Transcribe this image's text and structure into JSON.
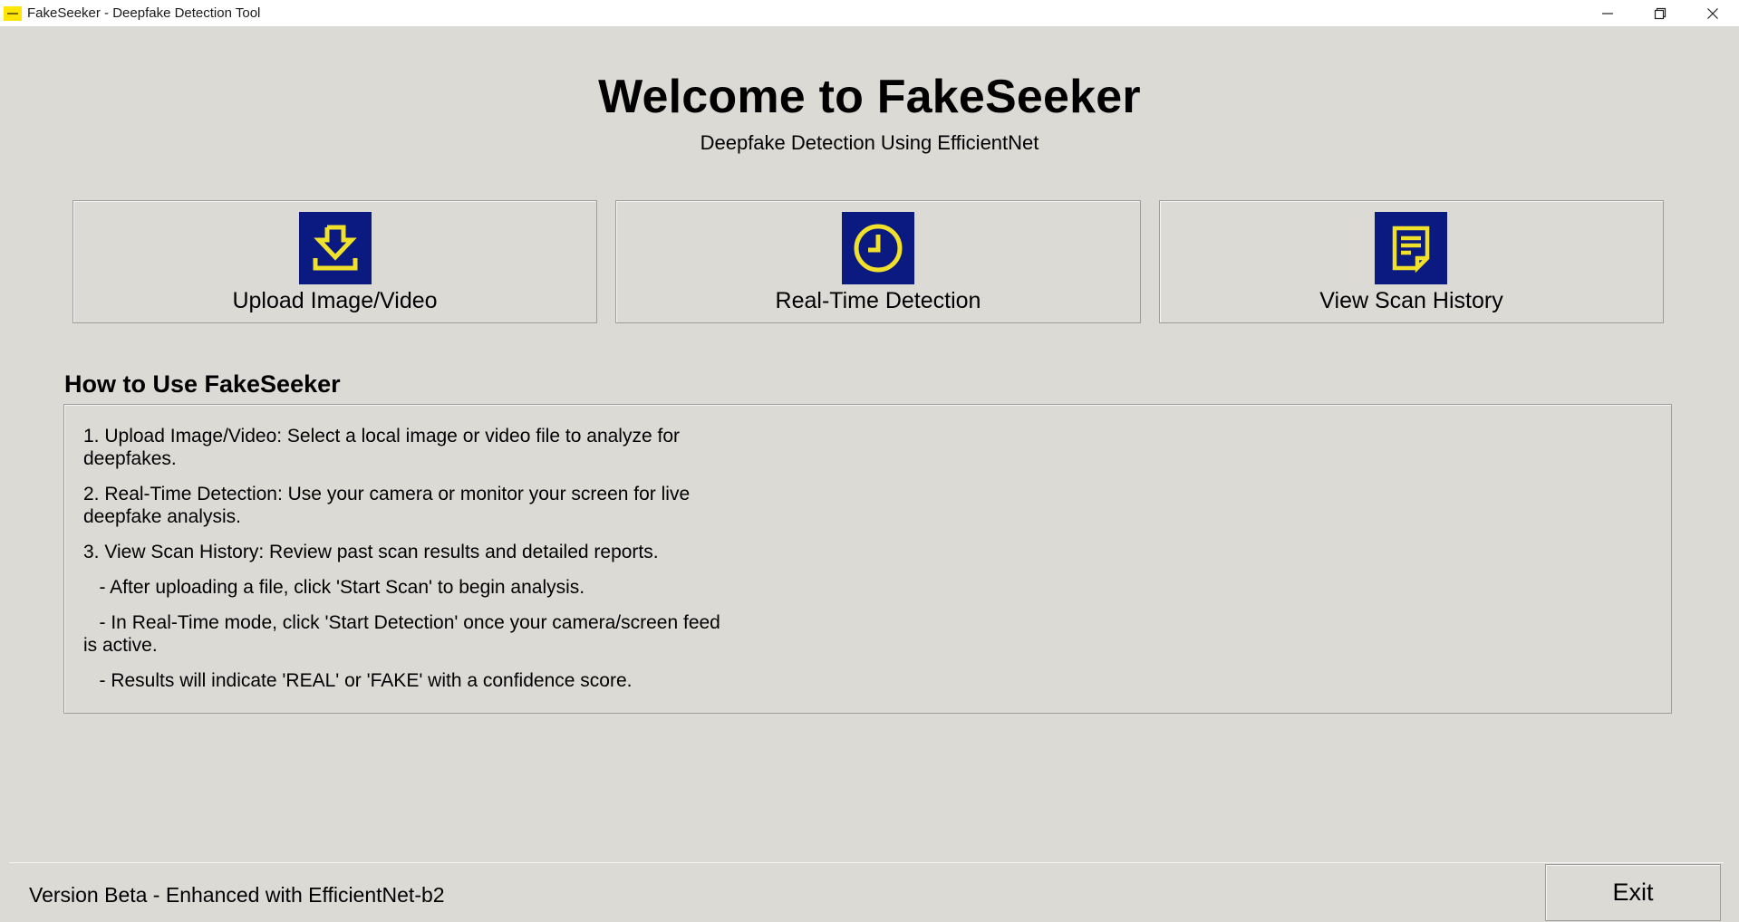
{
  "window": {
    "title": "FakeSeeker - Deepfake Detection Tool",
    "controls": {
      "minimize": "—",
      "restore": "❐",
      "close": "✕"
    }
  },
  "header": {
    "title": "Welcome to FakeSeeker",
    "subtitle": "Deepfake Detection Using EfficientNet"
  },
  "actions": [
    {
      "label": "Upload Image/Video",
      "icon": "download-icon"
    },
    {
      "label": "Real-Time Detection",
      "icon": "clock-icon"
    },
    {
      "label": "View Scan History",
      "icon": "document-icon"
    }
  ],
  "colors": {
    "icon_bg": "#0a1a80",
    "icon_fg": "#f2e12b",
    "window_bg": "#dcdad5"
  },
  "howto": {
    "heading": "How to Use FakeSeeker",
    "lines": [
      "1. Upload Image/Video: Select a local image or video file to analyze for deepfakes.",
      "2. Real-Time Detection: Use your camera or monitor your screen for live deepfake analysis.",
      "3. View Scan History: Review past scan results and detailed reports.",
      "   - After uploading a file, click 'Start Scan' to begin analysis.",
      "   - In Real-Time mode, click 'Start Detection' once your camera/screen feed is active.",
      "   - Results will indicate 'REAL' or 'FAKE' with a confidence score."
    ]
  },
  "footer": {
    "version": "Version Beta - Enhanced with EfficientNet-b2",
    "exit_label": "Exit"
  }
}
